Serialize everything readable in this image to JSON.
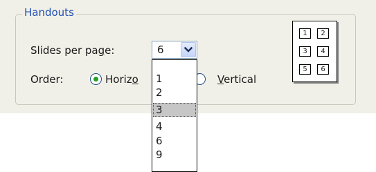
{
  "groupbox": {
    "title": "Handouts"
  },
  "slides_per_page": {
    "label": "Slides per page:",
    "value": "6",
    "options": [
      "1",
      "2",
      "3",
      "4",
      "6",
      "9"
    ],
    "highlighted_option": "3"
  },
  "order": {
    "label": "Order:",
    "options": [
      {
        "label": "Horizontal",
        "visible_text": "Horizo",
        "selected": true
      },
      {
        "label": "Vertical",
        "selected": false
      }
    ]
  },
  "preview": {
    "cells": [
      "1",
      "2",
      "3",
      "4",
      "5",
      "6"
    ]
  },
  "icons": {
    "combo_button": "chevron-down-icon"
  },
  "colors": {
    "legend_text": "#1f4fb3",
    "panel_bg": "#f1f0e8",
    "radio_dot": "#21a121",
    "highlight_bg": "#c7c6c6"
  }
}
